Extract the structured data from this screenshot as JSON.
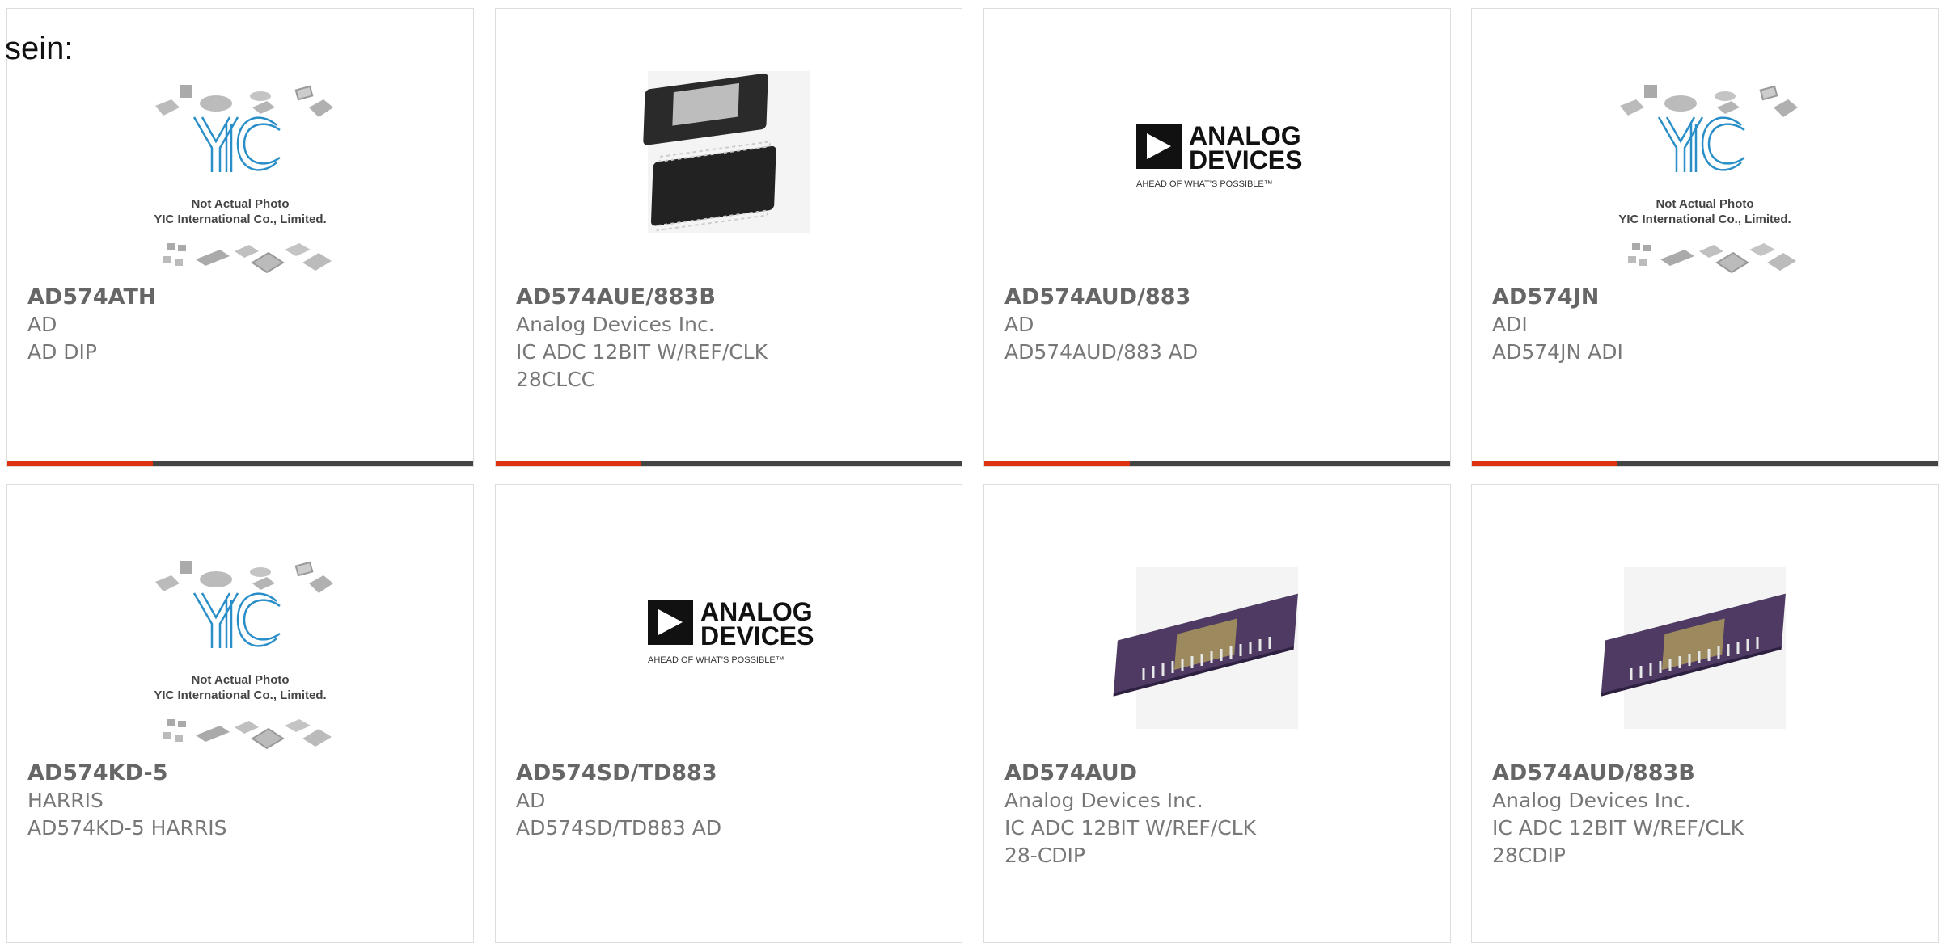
{
  "intro_text": "sein:",
  "colors": {
    "accent": "#dd3311",
    "bar": "#444444",
    "text": "#777777"
  },
  "products": [
    {
      "part_number": "AD574ATH",
      "manufacturer": "AD",
      "description": "AD DIP",
      "image": "yic-placeholder"
    },
    {
      "part_number": "AD574AUE/883B",
      "manufacturer": "Analog Devices Inc.",
      "description": "IC ADC 12BIT W/REF/CLK 28CLCC",
      "image": "plcc-chip-photo"
    },
    {
      "part_number": "AD574AUD/883",
      "manufacturer": "AD",
      "description": "AD574AUD/883 AD",
      "image": "analog-devices-logo"
    },
    {
      "part_number": "AD574JN",
      "manufacturer": "ADI",
      "description": "AD574JN ADI",
      "image": "yic-placeholder"
    },
    {
      "part_number": "AD574KD-5",
      "manufacturer": "HARRIS",
      "description": "AD574KD-5 HARRIS",
      "image": "yic-placeholder"
    },
    {
      "part_number": "AD574SD/TD883",
      "manufacturer": "AD",
      "description": "AD574SD/TD883 AD",
      "image": "analog-devices-logo"
    },
    {
      "part_number": "AD574AUD",
      "manufacturer": "Analog Devices Inc.",
      "description": "IC ADC 12BIT W/REF/CLK 28-CDIP",
      "image": "dip-chip-photo"
    },
    {
      "part_number": "AD574AUD/883B",
      "manufacturer": "Analog Devices Inc.",
      "description": "IC ADC 12BIT W/REF/CLK 28CDIP",
      "image": "dip-chip-photo"
    }
  ],
  "placeholder": {
    "line1": "Not Actual Photo",
    "line2": "YIC International Co., Limited.",
    "logo_text": "YIC"
  },
  "ad_logo": {
    "line1": "ANALOG",
    "line2": "DEVICES",
    "tagline": "AHEAD OF WHAT'S POSSIBLE™"
  }
}
